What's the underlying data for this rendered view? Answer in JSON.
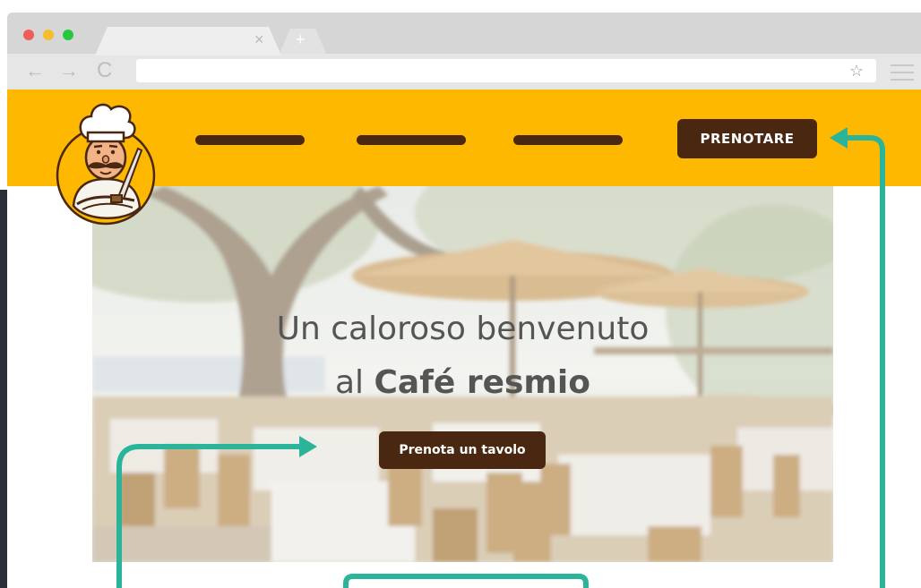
{
  "browser": {
    "tab_close_glyph": "×",
    "new_tab_glyph": "+",
    "back_glyph": "←",
    "forward_glyph": "→",
    "reload_glyph": "C",
    "star_glyph": "☆",
    "icons": [
      "back-arrow-icon",
      "forward-arrow-icon",
      "reload-icon",
      "star-icon",
      "menu-icon",
      "close-icon",
      "plus-icon"
    ]
  },
  "header": {
    "reserve_label": "PRENOTARE",
    "logo_icon": "chef-mascot-icon"
  },
  "hero": {
    "headline_line1": "Un caloroso benvenuto",
    "headline_prefix": "al",
    "headline_brand": "Café resmio",
    "cta_label": "Prenota un tavolo"
  },
  "colors": {
    "header_bg": "#ffb800",
    "button_bg": "#4a2710",
    "annotation": "#2ab49a"
  }
}
